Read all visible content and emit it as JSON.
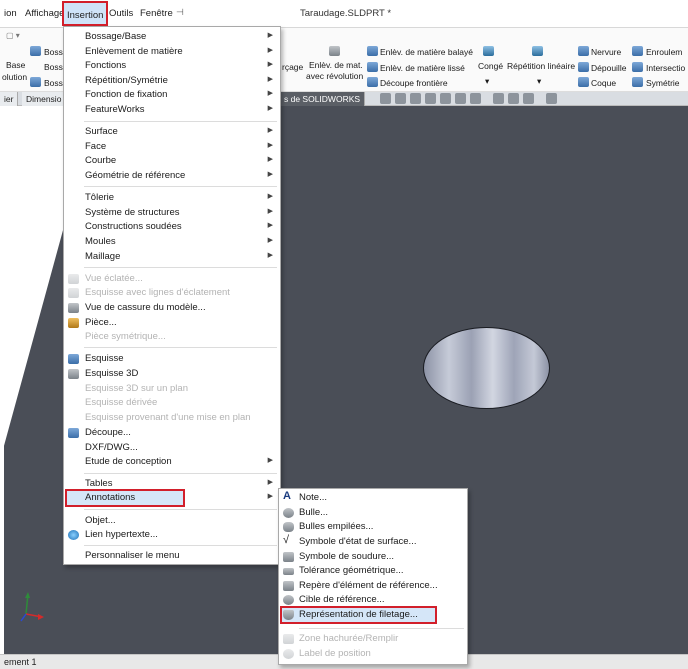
{
  "menubar": {
    "items": [
      "ion",
      "Affichage",
      "Insertion",
      "Outils",
      "Fenêtre"
    ],
    "pin": "⊣",
    "title": "Taraudage.SLDPRT *"
  },
  "ribbon": {
    "quick_access": "▢ ▾",
    "base_fragment": "Base",
    "revolution_fragment": "olution",
    "bossage_1": "Bossa",
    "bossage_2": "Bossa",
    "bossage_3": "Bossa",
    "percage": "rçage",
    "enlev_mat_1": "Enlèv. de mat.",
    "enlev_mat_2": "avec révolution",
    "enlev_balaye": "Enlèv. de matière balayé",
    "enlev_lisse": "Enlèv. de matière lissé",
    "decoupe_frontiere": "Découpe frontière",
    "conge": "Congé",
    "repetition_lineaire": "Répétition linéaire",
    "nervure": "Nervure",
    "depouille": "Dépouille",
    "coque": "Coque",
    "enroulement": "Enroulem",
    "intersection": "Intersectio",
    "symetrie": "Symétrie",
    "dropdown_1": "▾",
    "dropdown_2": "▾"
  },
  "tabs": [
    "ier",
    "Dimensio",
    "s de SOLIDWORKS"
  ],
  "status": {
    "text": "ement 1"
  },
  "main_menu": {
    "items": [
      {
        "label": "Bossage/Base",
        "arrow": "▶"
      },
      {
        "label": "Enlèvement de matière",
        "arrow": "▶"
      },
      {
        "label": "Fonctions",
        "arrow": "▶"
      },
      {
        "label": "Répétition/Symétrie",
        "arrow": "▶"
      },
      {
        "label": "Fonction de fixation",
        "arrow": "▶"
      },
      {
        "label": "FeatureWorks",
        "arrow": "▶"
      },
      {
        "label": "Surface",
        "arrow": "▶"
      },
      {
        "label": "Face",
        "arrow": "▶"
      },
      {
        "label": "Courbe",
        "arrow": "▶"
      },
      {
        "label": "Géométrie de référence",
        "arrow": "▶"
      },
      {
        "label": "Tôlerie",
        "arrow": "▶"
      },
      {
        "label": "Système de structures",
        "arrow": "▶"
      },
      {
        "label": "Constructions soudées",
        "arrow": "▶"
      },
      {
        "label": "Moules",
        "arrow": "▶"
      },
      {
        "label": "Maillage",
        "arrow": "▶"
      },
      {
        "label": "Vue éclatée..."
      },
      {
        "label": "Esquisse avec lignes d'éclatement"
      },
      {
        "label": "Vue de cassure du modèle..."
      },
      {
        "label": "Pièce..."
      },
      {
        "label": "Pièce symétrique..."
      },
      {
        "label": "Esquisse"
      },
      {
        "label": "Esquisse 3D"
      },
      {
        "label": "Esquisse 3D sur un plan"
      },
      {
        "label": "Esquisse dérivée"
      },
      {
        "label": "Esquisse provenant d'une mise en plan"
      },
      {
        "label": "Découpe..."
      },
      {
        "label": "DXF/DWG..."
      },
      {
        "label": "Etude de conception",
        "arrow": "▶"
      },
      {
        "label": "Tables",
        "arrow": "▶"
      },
      {
        "label": "Annotations",
        "arrow": "▶"
      },
      {
        "label": "Objet..."
      },
      {
        "label": "Lien hypertexte..."
      },
      {
        "label": "Personnaliser le menu"
      }
    ]
  },
  "annotations_menu": {
    "items": [
      {
        "label": "Note..."
      },
      {
        "label": "Bulle..."
      },
      {
        "label": "Bulles empilées..."
      },
      {
        "label": "Symbole d'état de surface..."
      },
      {
        "label": "Symbole de soudure..."
      },
      {
        "label": "Tolérance géométrique..."
      },
      {
        "label": "Repère d'élément de référence..."
      },
      {
        "label": "Cible de référence..."
      },
      {
        "label": "Représentation de filetage..."
      },
      {
        "label": "Zone hachurée/Remplir"
      },
      {
        "label": "Label de position"
      }
    ]
  }
}
